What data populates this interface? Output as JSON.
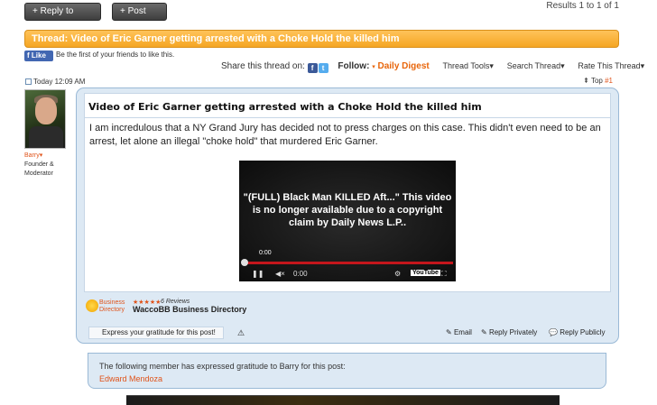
{
  "toolbar": {
    "reply_label": "+ Reply to Thread",
    "post_to_label": "+ Post To:"
  },
  "results": "Results 1 to 1 of 1",
  "thread": {
    "title_bar": "Thread: Video of Eric Garner getting arrested with a Choke Hold the killed him"
  },
  "facebook": {
    "like_label": "Like",
    "prompt": "Be the first of your friends to like this."
  },
  "share": {
    "label": "Share this thread on:",
    "follow_label": "Follow:",
    "digest_label": "Daily Digest",
    "tools": [
      "Thread Tools",
      "Search Thread",
      "Rate This Thread"
    ]
  },
  "post": {
    "date": "Today 12:09 AM",
    "top_label": "Top",
    "number": "#1",
    "title": "Video of Eric Garner getting arrested with a Choke Hold the killed him",
    "body": "I am incredulous that a NY Grand Jury has decided not to press charges on this case. This didn't even need to be an arrest, let alone an illegal \"choke hold\" that murdered Eric Garner."
  },
  "author": {
    "name": "Barry",
    "role_line1": "Founder &",
    "role_line2": "Moderator"
  },
  "video": {
    "message": "\"(FULL) Black Man KILLED Aft...\" This video is no longer available due to a copyright claim by Daily News L.P..",
    "time_top": "0:00",
    "time_bottom": "0:00",
    "brand": "YouTube"
  },
  "business": {
    "label_line1": "Business",
    "label_line2": "Directory",
    "stars": "★★★★★",
    "reviews": "6 Reviews",
    "name": "WaccoBB Business Directory"
  },
  "actions": {
    "gratitude": "Express your gratitude for this post!",
    "email": "Email",
    "reply_privately": "Reply Privately",
    "reply_publicly": "Reply Publicly"
  },
  "thanks": {
    "text": "The following member has expressed gratitude to Barry for this post:",
    "member": "Edward Mendoza"
  }
}
